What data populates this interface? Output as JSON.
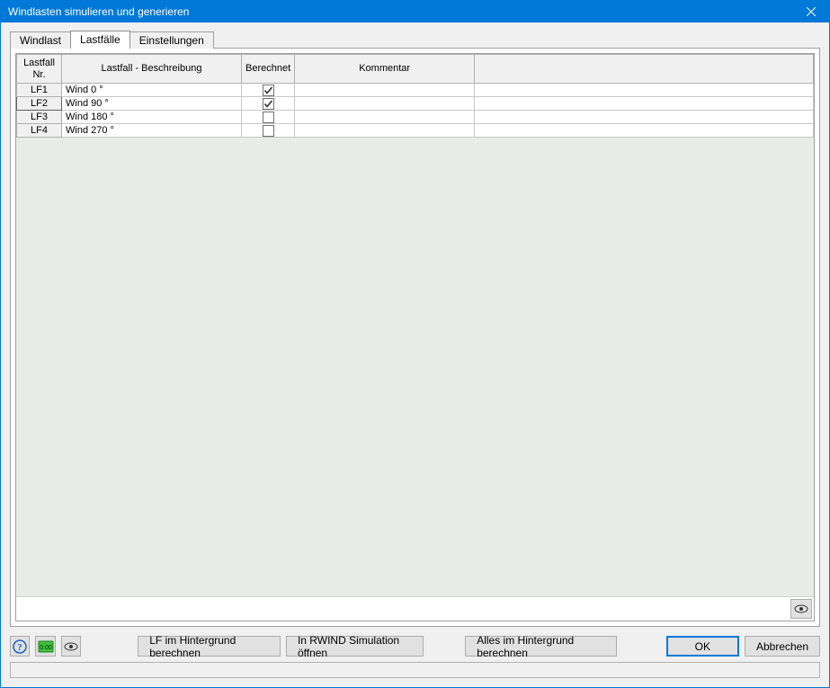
{
  "window": {
    "title": "Windlasten simulieren und generieren"
  },
  "tabs": [
    {
      "label": "Windlast",
      "active": false
    },
    {
      "label": "Lastfälle",
      "active": true
    },
    {
      "label": "Einstellungen",
      "active": false
    }
  ],
  "grid": {
    "headers": {
      "nr_line1": "Lastfall",
      "nr_line2": "Nr.",
      "desc": "Lastfall - Beschreibung",
      "calc": "Berechnet",
      "kom": "Kommentar"
    },
    "rows": [
      {
        "nr": "LF1",
        "desc": "Wind 0 °",
        "calc": true,
        "kom": "",
        "selected": false
      },
      {
        "nr": "LF2",
        "desc": "Wind 90 °",
        "calc": true,
        "kom": "",
        "selected": true
      },
      {
        "nr": "LF3",
        "desc": "Wind 180 °",
        "calc": false,
        "kom": "",
        "selected": false
      },
      {
        "nr": "LF4",
        "desc": "Wind 270 °",
        "calc": false,
        "kom": "",
        "selected": false
      }
    ]
  },
  "buttons": {
    "lf_bg": "LF  im Hintergrund berechnen",
    "open_rwind": "In RWIND Simulation öffnen",
    "all_bg": "Alles im Hintergrund berechnen",
    "ok": "OK",
    "cancel": "Abbrechen"
  },
  "icons": {
    "help": "help-icon",
    "units": "units-icon",
    "view": "eye-icon",
    "grid_view": "eye-icon",
    "close": "close-icon"
  }
}
